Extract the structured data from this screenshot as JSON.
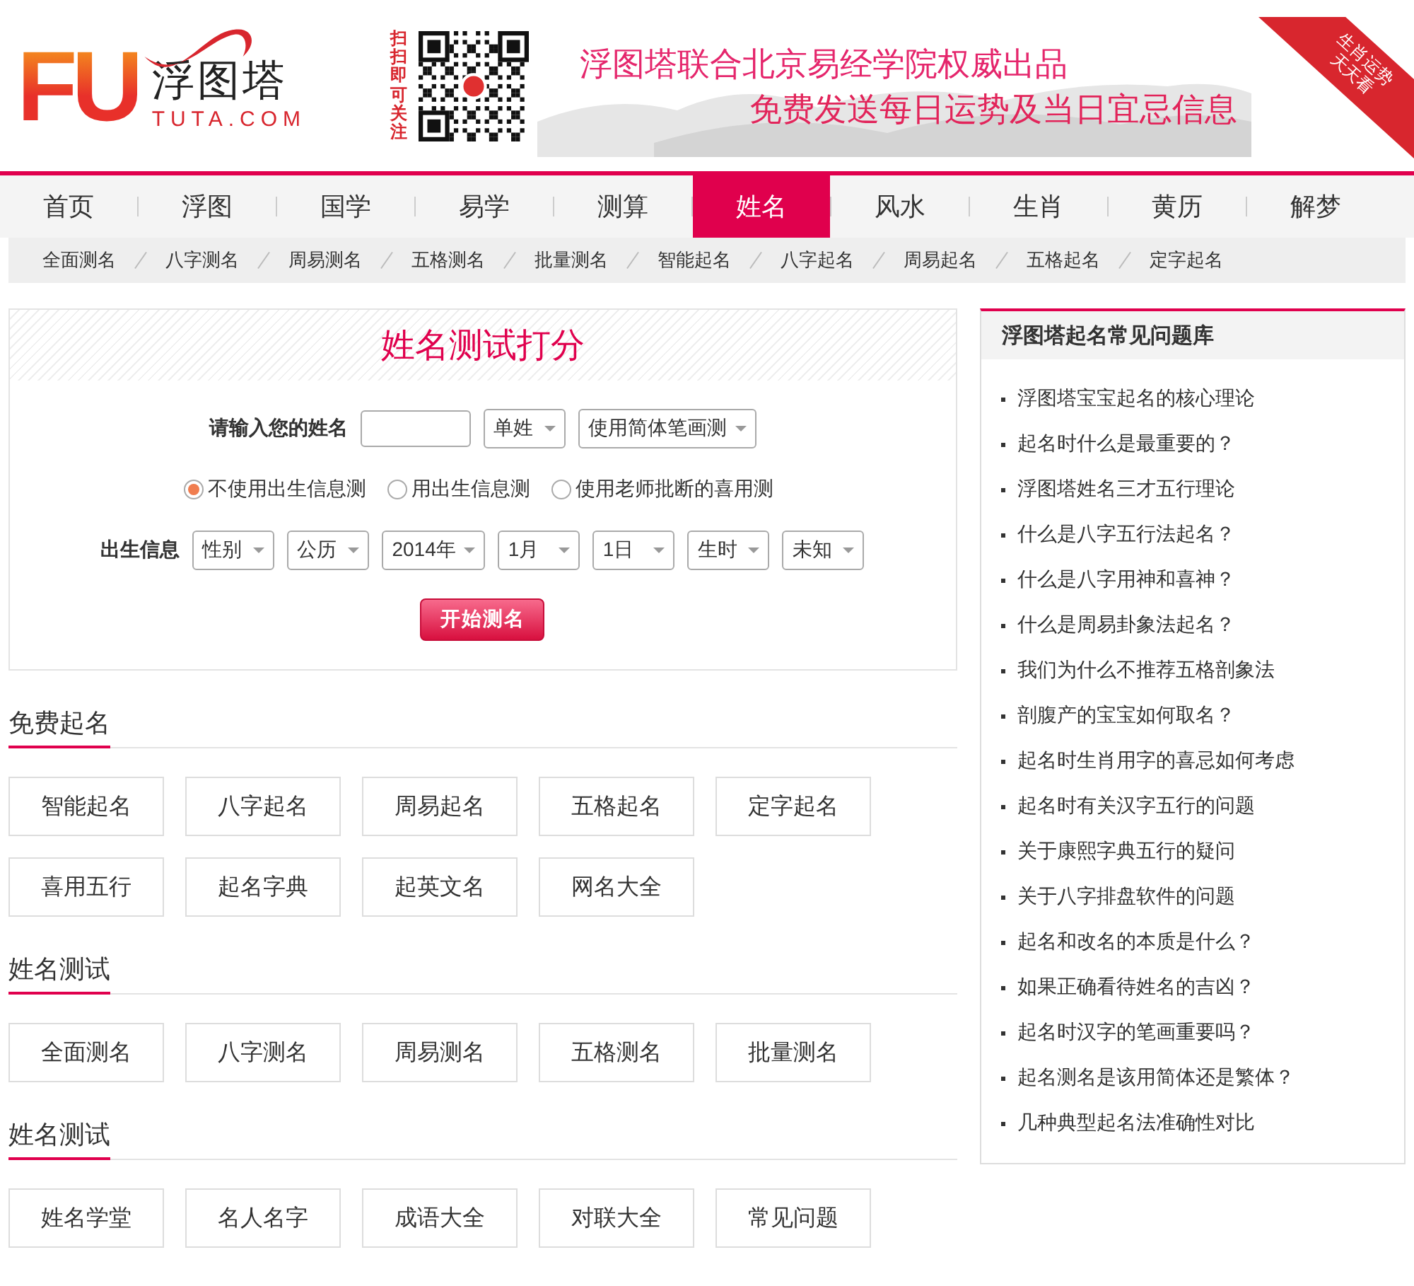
{
  "header": {
    "logo": {
      "letters": "FU",
      "name": "浮图塔",
      "domain": "TUTA.COM"
    },
    "qr_caption": "扫扫即可关注",
    "banner": {
      "line1": "浮图塔联合北京易经学院权威出品",
      "line2": "免费发送每日运势及当日宜忌信息"
    },
    "ribbon": {
      "line1": "生肖运势",
      "line2": "天天看"
    }
  },
  "nav": [
    {
      "label": "首页",
      "selected": false
    },
    {
      "label": "浮图",
      "selected": false
    },
    {
      "label": "国学",
      "selected": false
    },
    {
      "label": "易学",
      "selected": false
    },
    {
      "label": "测算",
      "selected": false
    },
    {
      "label": "姓名",
      "selected": true
    },
    {
      "label": "风水",
      "selected": false
    },
    {
      "label": "生肖",
      "selected": false
    },
    {
      "label": "黄历",
      "selected": false
    },
    {
      "label": "解梦",
      "selected": false
    }
  ],
  "subnav": [
    "全面测名",
    "八字测名",
    "周易测名",
    "五格测名",
    "批量测名",
    "智能起名",
    "八字起名",
    "周易起名",
    "五格起名",
    "定字起名"
  ],
  "form": {
    "title": "姓名测试打分",
    "name_label": "请输入您的姓名",
    "name_selects": [
      "单姓",
      "使用简体笔画测"
    ],
    "radios": [
      {
        "label": "不使用出生信息测",
        "selected": true
      },
      {
        "label": "用出生信息测",
        "selected": false
      },
      {
        "label": "使用老师批断的喜用测",
        "selected": false
      }
    ],
    "birth_label": "出生信息",
    "birth_selects": [
      "性别",
      "公历",
      "2014年",
      "1月",
      "1日",
      "生时",
      "未知"
    ],
    "submit": "开始测名"
  },
  "sections": [
    {
      "title": "免费起名",
      "links": [
        "智能起名",
        "八字起名",
        "周易起名",
        "五格起名",
        "定字起名",
        "喜用五行",
        "起名字典",
        "起英文名",
        "网名大全"
      ]
    },
    {
      "title": "姓名测试",
      "links": [
        "全面测名",
        "八字测名",
        "周易测名",
        "五格测名",
        "批量测名"
      ]
    },
    {
      "title": "姓名测试",
      "links": [
        "姓名学堂",
        "名人名字",
        "成语大全",
        "对联大全",
        "常见问题"
      ]
    }
  ],
  "sidebar": {
    "title": "浮图塔起名常见问题库",
    "items": [
      "浮图塔宝宝起名的核心理论",
      "起名时什么是最重要的？",
      "浮图塔姓名三才五行理论",
      "什么是八字五行法起名？",
      "什么是八字用神和喜神？",
      "什么是周易卦象法起名？",
      "我们为什么不推荐五格剖象法",
      "剖腹产的宝宝如何取名？",
      "起名时生肖用字的喜忌如何考虑",
      "起名时有关汉字五行的问题",
      "关于康熙字典五行的疑问",
      "关于八字排盘软件的问题",
      "起名和改名的本质是什么？",
      "如果正确看待姓名的吉凶？",
      "起名时汉字的笔画重要吗？",
      "起名测名是该用简体还是繁体？",
      "几种典型起名法准确性对比"
    ]
  }
}
